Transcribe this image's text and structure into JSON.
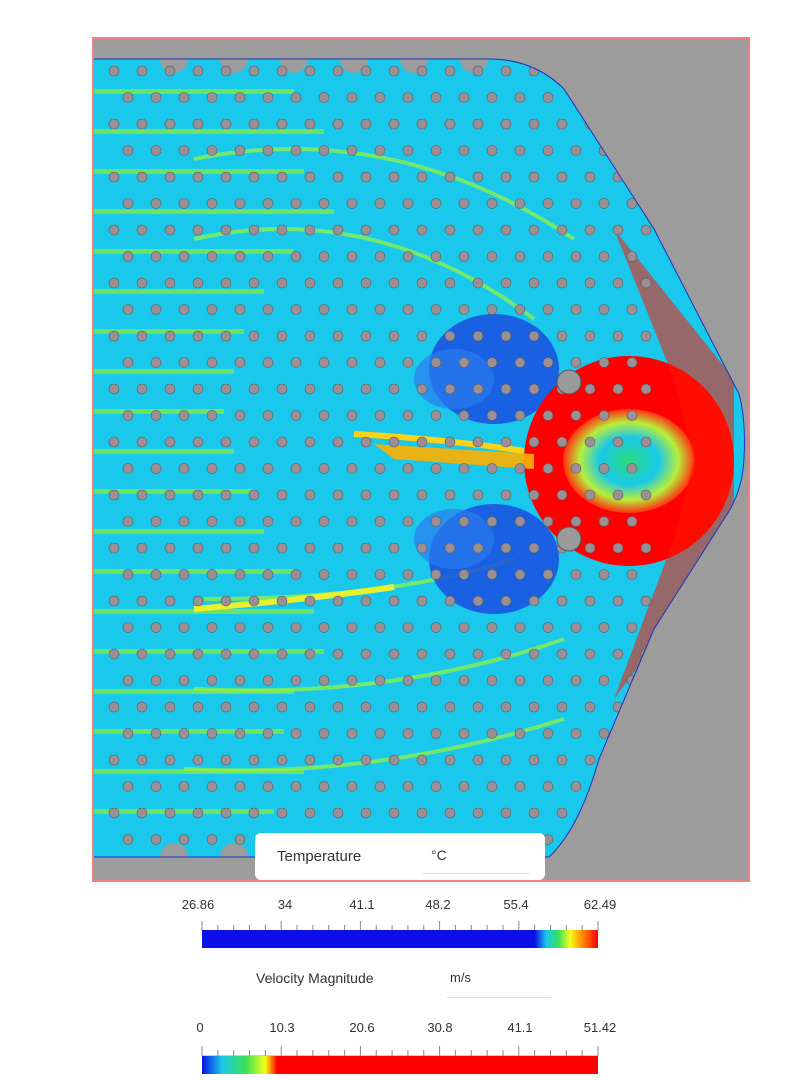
{
  "temperature_legend": {
    "title": "Temperature",
    "unit": "°C",
    "ticks": [
      "26.86",
      "34",
      "41.1",
      "48.2",
      "55.4",
      "62.49"
    ]
  },
  "velocity_legend": {
    "title": "Velocity Magnitude",
    "unit": "m/s",
    "ticks": [
      "0",
      "10.3",
      "20.6",
      "30.8",
      "41.1",
      "51.42"
    ]
  },
  "colors": {
    "background_gray": "#9c9c9c",
    "frame_border": "#f08080",
    "field_base": "#19c8ea",
    "hot": "#ff0000",
    "cold": "#0a1ee6"
  }
}
